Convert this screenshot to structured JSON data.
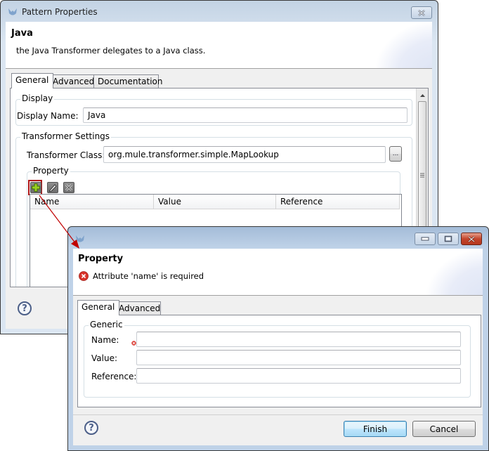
{
  "pattern_window": {
    "title": "Pattern Properties",
    "header": {
      "title": "Java",
      "description": "the Java Transformer delegates to a Java class."
    },
    "tabs": [
      {
        "label": "General",
        "active": true
      },
      {
        "label": "Advanced",
        "active": false
      },
      {
        "label": "Documentation",
        "active": false
      }
    ],
    "display_group": {
      "label": "Display",
      "display_name_label": "Display Name:",
      "display_name_value": "Java"
    },
    "transformer_group": {
      "label": "Transformer Settings",
      "class_label": "Transformer Class:",
      "class_value": "org.mule.transformer.simple.MapLookup",
      "browse_label": "..."
    },
    "property_group": {
      "label": "Property",
      "toolbar": [
        {
          "icon": "add-icon",
          "highlighted": true
        },
        {
          "icon": "edit-pencil-icon",
          "highlighted": false
        },
        {
          "icon": "delete-icon",
          "highlighted": false
        }
      ],
      "columns": [
        "Name",
        "Value",
        "Reference"
      ],
      "rows": []
    },
    "help_icon": "help-icon",
    "close_icon": "close-icon"
  },
  "property_window": {
    "title": "",
    "header": {
      "title": "Property",
      "error_message": "Attribute 'name' is required"
    },
    "tabs": [
      {
        "label": "General",
        "active": true
      },
      {
        "label": "Advanced",
        "active": false
      }
    ],
    "generic_group": {
      "label": "Generic",
      "fields": [
        {
          "label": "Name:",
          "value": "",
          "error": true
        },
        {
          "label": "Value:",
          "value": "",
          "error": false
        },
        {
          "label": "Reference:",
          "value": "",
          "error": false
        }
      ]
    },
    "buttons": {
      "finish": "Finish",
      "cancel": "Cancel"
    }
  },
  "annotation": {
    "color": "#c00000",
    "description": "arrow from add button to Property dialog"
  }
}
